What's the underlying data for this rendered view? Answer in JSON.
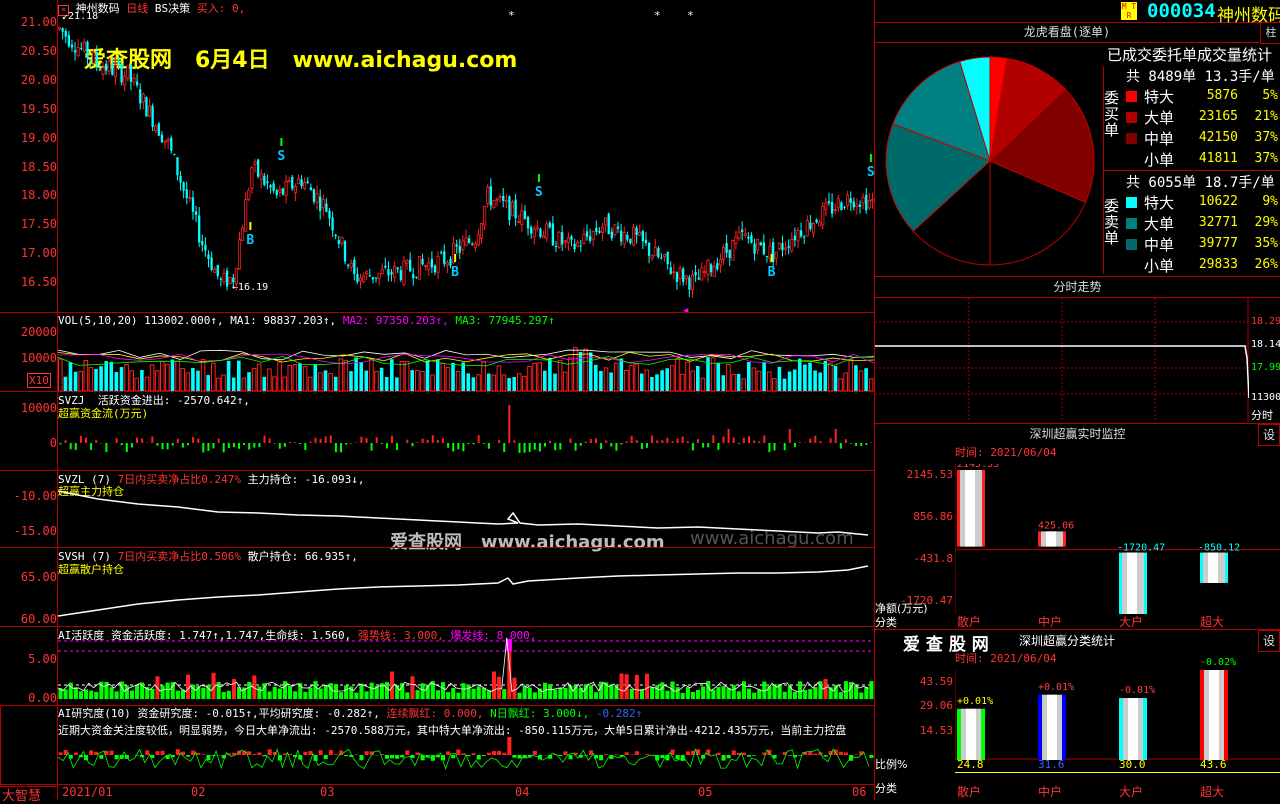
{
  "header": {
    "stock_name": "神州数码",
    "period": "日线",
    "bs_label": "BS决策",
    "buy_label": "买入:",
    "buy_value": "0,",
    "code": "000034",
    "code_name": "神州数码",
    "mtr": "M T R",
    "high_marker": "21.18",
    "low_marker": "16.19"
  },
  "watermark": {
    "site": "爱查股网",
    "date": "6月4日",
    "url": "www.aichagu.com",
    "mid_site": "爱查股网",
    "mid_url": "www.aichagu.com",
    "mid_faded": "www.aichagu.com"
  },
  "price_axis": [
    "21.00",
    "20.50",
    "20.00",
    "19.50",
    "19.00",
    "18.50",
    "18.00",
    "17.50",
    "17.00",
    "16.50"
  ],
  "vol": {
    "header_parts": [
      "VOL(5,10,20)",
      "113002.000↑,",
      "MA1: 98837.203↑,",
      "MA2: 97350.203↑,",
      "MA3: 77945.297↑"
    ],
    "axis": [
      "20000",
      "10000"
    ],
    "x10": "X10"
  },
  "svzj": {
    "name": "SVZJ",
    "l1a": "活跃资金进出: -2570.642↑,",
    "l2": "超赢资金流(万元)",
    "axis": [
      "10000",
      "0"
    ]
  },
  "svzl": {
    "name": "SVZL (7)",
    "l1a": "7日内买卖净占比0.247%",
    "l1b": "主力持仓: -16.093↓,",
    "l2": "超赢主力持仓",
    "axis": [
      "-10.00",
      "-15.00"
    ]
  },
  "svsh": {
    "name": "SVSH (7)",
    "l1a": "7日内买卖净占比0.506%",
    "l1b": "散户持仓: 66.935↑,",
    "l2": "超赢散户持仓",
    "axis": [
      "65.00",
      "60.00"
    ]
  },
  "ai_active": {
    "name": "AI活跃度",
    "a": "资金活跃度: 1.747↑,1.747,",
    "b": "生命线: 1.560,",
    "c": "强势线: 3.000,",
    "d": "爆发线: 8.000,",
    "axis": [
      "5.00",
      "0.00"
    ]
  },
  "ai_research": {
    "name": "AI研究度(10)",
    "a": "资金研究度: -0.015↑,",
    "b": "平均研究度: -0.282↑,",
    "c": "连续飘红: 0.000,",
    "d": "N日飘红: 3.000↓,",
    "e": "-0.282↑",
    "line2": "近期大资金关注度较低，明显弱势，今日大单净流出: -2570.588万元，其中特大单净流出: -850.115万元，大单5日累计净出-4212.435万元，当前主力控盘"
  },
  "date_axis": [
    "2021/01",
    "02",
    "03",
    "04",
    "05",
    "06"
  ],
  "bottom_left": "大智慧",
  "dragon": {
    "title": "龙虎看盘(逐单)",
    "subtitle": "已成交委托单成交量统计",
    "buy_label": "委买单",
    "sell_label": "委卖单",
    "buy_total": "共 8489单 13.3手/单",
    "sell_total": "共 6055单 18.7手/单",
    "buy_rows": [
      {
        "name": "特大",
        "vol": "5876",
        "pct": "5%",
        "color": "#ff0000"
      },
      {
        "name": "大单",
        "vol": "23165",
        "pct": "21%",
        "color": "#b00000"
      },
      {
        "name": "中单",
        "vol": "42150",
        "pct": "37%",
        "color": "#800000"
      },
      {
        "name": "小单",
        "vol": "41811",
        "pct": "37%",
        "color": "#000000"
      }
    ],
    "sell_rows": [
      {
        "name": "特大",
        "vol": "10622",
        "pct": "9%",
        "color": "#00ffff"
      },
      {
        "name": "大单",
        "vol": "32771",
        "pct": "29%",
        "color": "#008080"
      },
      {
        "name": "中单",
        "vol": "39777",
        "pct": "35%",
        "color": "#006a6a"
      },
      {
        "name": "小单",
        "vol": "29833",
        "pct": "26%",
        "color": "#000000"
      }
    ]
  },
  "tabs": {
    "zhu": "柱",
    "she": "设"
  },
  "intraday": {
    "title": "分时走势",
    "axis": [
      "18.29",
      "18.14",
      "17.99",
      "11300",
      "分时"
    ]
  },
  "monitor": {
    "title": "深圳超赢实时监控",
    "time": "时间: 2021/06/04",
    "set": "设",
    "ylabel": "净额(万元)",
    "xlabel": "分类",
    "axis": [
      "2145.53",
      "856.86",
      "-431.8",
      "-1720.47"
    ],
    "cats": [
      "散户",
      "中户",
      "大户",
      "超大"
    ],
    "values": [
      "2145.53",
      "425.06",
      "-1720.47",
      "-850.12"
    ]
  },
  "stats": {
    "title": "深圳超赢分类统计",
    "brand": "爱 查 股 网",
    "time": "时间: 2021/06/04",
    "set": "设",
    "ylabel": "比例%",
    "xlabel": "分类",
    "axis": [
      "43.59",
      "29.06",
      "14.53"
    ],
    "cats": [
      "散户",
      "中户",
      "大户",
      "超大"
    ],
    "top": [
      "+0.01%",
      "+0.01%",
      "-0.01%",
      "-0.02%"
    ],
    "bottom": [
      "24.8",
      "31.6",
      "30.0",
      "43.6"
    ],
    "colors": [
      "#00ff00",
      "#0000ff",
      "#00ffff",
      "#ff0000"
    ]
  },
  "chart_data": [
    {
      "type": "candlestick",
      "title": "神州数码 日线",
      "ylim": [
        16.0,
        21.4
      ],
      "high": 21.18,
      "low": 16.19
    },
    {
      "type": "pie",
      "title": "龙虎看盘(逐单)",
      "labels": [
        "买特大",
        "买大单",
        "买中单",
        "买小单",
        "卖小单",
        "卖中单",
        "卖大单",
        "卖特大"
      ],
      "values": [
        5876,
        23165,
        42150,
        41811,
        29833,
        39777,
        32771,
        10622
      ]
    },
    {
      "type": "bar",
      "title": "深圳超赢实时监控",
      "categories": [
        "散户",
        "中户",
        "大户",
        "超大"
      ],
      "values": [
        2145.53,
        425.06,
        -1720.47,
        -850.12
      ],
      "ylabel": "净额(万元)",
      "ylim": [
        -1720.47,
        2145.53
      ]
    },
    {
      "type": "bar",
      "title": "深圳超赢分类统计",
      "categories": [
        "散户",
        "中户",
        "大户",
        "超大"
      ],
      "values": [
        24.8,
        31.6,
        30.0,
        43.6
      ],
      "ylabel": "比例%",
      "ylim": [
        0,
        43.59
      ]
    }
  ]
}
